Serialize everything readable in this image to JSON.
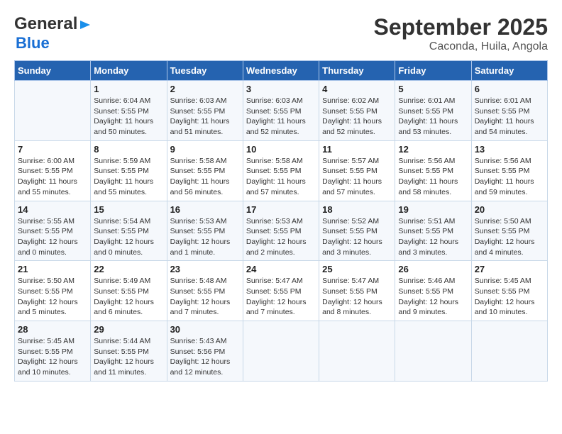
{
  "header": {
    "logo_general": "General",
    "logo_blue": "Blue",
    "title": "September 2025",
    "subtitle": "Caconda, Huila, Angola"
  },
  "calendar": {
    "days_of_week": [
      "Sunday",
      "Monday",
      "Tuesday",
      "Wednesday",
      "Thursday",
      "Friday",
      "Saturday"
    ],
    "weeks": [
      [
        {
          "day": "",
          "detail": ""
        },
        {
          "day": "1",
          "detail": "Sunrise: 6:04 AM\nSunset: 5:55 PM\nDaylight: 11 hours\nand 50 minutes."
        },
        {
          "day": "2",
          "detail": "Sunrise: 6:03 AM\nSunset: 5:55 PM\nDaylight: 11 hours\nand 51 minutes."
        },
        {
          "day": "3",
          "detail": "Sunrise: 6:03 AM\nSunset: 5:55 PM\nDaylight: 11 hours\nand 52 minutes."
        },
        {
          "day": "4",
          "detail": "Sunrise: 6:02 AM\nSunset: 5:55 PM\nDaylight: 11 hours\nand 52 minutes."
        },
        {
          "day": "5",
          "detail": "Sunrise: 6:01 AM\nSunset: 5:55 PM\nDaylight: 11 hours\nand 53 minutes."
        },
        {
          "day": "6",
          "detail": "Sunrise: 6:01 AM\nSunset: 5:55 PM\nDaylight: 11 hours\nand 54 minutes."
        }
      ],
      [
        {
          "day": "7",
          "detail": "Sunrise: 6:00 AM\nSunset: 5:55 PM\nDaylight: 11 hours\nand 55 minutes."
        },
        {
          "day": "8",
          "detail": "Sunrise: 5:59 AM\nSunset: 5:55 PM\nDaylight: 11 hours\nand 55 minutes."
        },
        {
          "day": "9",
          "detail": "Sunrise: 5:58 AM\nSunset: 5:55 PM\nDaylight: 11 hours\nand 56 minutes."
        },
        {
          "day": "10",
          "detail": "Sunrise: 5:58 AM\nSunset: 5:55 PM\nDaylight: 11 hours\nand 57 minutes."
        },
        {
          "day": "11",
          "detail": "Sunrise: 5:57 AM\nSunset: 5:55 PM\nDaylight: 11 hours\nand 57 minutes."
        },
        {
          "day": "12",
          "detail": "Sunrise: 5:56 AM\nSunset: 5:55 PM\nDaylight: 11 hours\nand 58 minutes."
        },
        {
          "day": "13",
          "detail": "Sunrise: 5:56 AM\nSunset: 5:55 PM\nDaylight: 11 hours\nand 59 minutes."
        }
      ],
      [
        {
          "day": "14",
          "detail": "Sunrise: 5:55 AM\nSunset: 5:55 PM\nDaylight: 12 hours\nand 0 minutes."
        },
        {
          "day": "15",
          "detail": "Sunrise: 5:54 AM\nSunset: 5:55 PM\nDaylight: 12 hours\nand 0 minutes."
        },
        {
          "day": "16",
          "detail": "Sunrise: 5:53 AM\nSunset: 5:55 PM\nDaylight: 12 hours\nand 1 minute."
        },
        {
          "day": "17",
          "detail": "Sunrise: 5:53 AM\nSunset: 5:55 PM\nDaylight: 12 hours\nand 2 minutes."
        },
        {
          "day": "18",
          "detail": "Sunrise: 5:52 AM\nSunset: 5:55 PM\nDaylight: 12 hours\nand 3 minutes."
        },
        {
          "day": "19",
          "detail": "Sunrise: 5:51 AM\nSunset: 5:55 PM\nDaylight: 12 hours\nand 3 minutes."
        },
        {
          "day": "20",
          "detail": "Sunrise: 5:50 AM\nSunset: 5:55 PM\nDaylight: 12 hours\nand 4 minutes."
        }
      ],
      [
        {
          "day": "21",
          "detail": "Sunrise: 5:50 AM\nSunset: 5:55 PM\nDaylight: 12 hours\nand 5 minutes."
        },
        {
          "day": "22",
          "detail": "Sunrise: 5:49 AM\nSunset: 5:55 PM\nDaylight: 12 hours\nand 6 minutes."
        },
        {
          "day": "23",
          "detail": "Sunrise: 5:48 AM\nSunset: 5:55 PM\nDaylight: 12 hours\nand 7 minutes."
        },
        {
          "day": "24",
          "detail": "Sunrise: 5:47 AM\nSunset: 5:55 PM\nDaylight: 12 hours\nand 7 minutes."
        },
        {
          "day": "25",
          "detail": "Sunrise: 5:47 AM\nSunset: 5:55 PM\nDaylight: 12 hours\nand 8 minutes."
        },
        {
          "day": "26",
          "detail": "Sunrise: 5:46 AM\nSunset: 5:55 PM\nDaylight: 12 hours\nand 9 minutes."
        },
        {
          "day": "27",
          "detail": "Sunrise: 5:45 AM\nSunset: 5:55 PM\nDaylight: 12 hours\nand 10 minutes."
        }
      ],
      [
        {
          "day": "28",
          "detail": "Sunrise: 5:45 AM\nSunset: 5:55 PM\nDaylight: 12 hours\nand 10 minutes."
        },
        {
          "day": "29",
          "detail": "Sunrise: 5:44 AM\nSunset: 5:55 PM\nDaylight: 12 hours\nand 11 minutes."
        },
        {
          "day": "30",
          "detail": "Sunrise: 5:43 AM\nSunset: 5:56 PM\nDaylight: 12 hours\nand 12 minutes."
        },
        {
          "day": "",
          "detail": ""
        },
        {
          "day": "",
          "detail": ""
        },
        {
          "day": "",
          "detail": ""
        },
        {
          "day": "",
          "detail": ""
        }
      ]
    ]
  }
}
